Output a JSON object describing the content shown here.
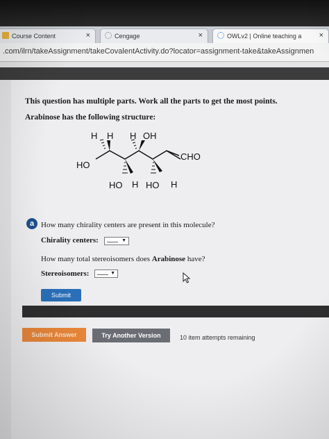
{
  "browser": {
    "tabs": [
      {
        "label": "Course Content",
        "close": "×"
      },
      {
        "label": "Cengage",
        "close": "×"
      },
      {
        "label": "OWLv2 | Online teaching a",
        "close": "×"
      }
    ],
    "url": ".com/ilrn/takeAssignment/takeCovalentActivity.do?locator=assignment-take&takeAssignmen"
  },
  "question": {
    "intro": "This question has multiple parts. Work all the parts to get the most points.",
    "structure_label": "Arabinose has the following structure:",
    "molecule_labels": {
      "h1": "H",
      "h2": "H",
      "h3": "H",
      "oh": "OH",
      "cho": "CHO",
      "ho_left": "HO",
      "ho_bottom1": "HO",
      "h_bottom1": "H",
      "ho_bottom2": "HO",
      "h_bottom2": "H"
    },
    "part_a": {
      "badge": "a",
      "chirality_question": "How many chirality centers are present in this molecule?",
      "chirality_label": "Chirality centers:",
      "chirality_value": "",
      "stereo_question_prefix": "How many total stereoisomers does ",
      "stereo_question_bold": "Arabinose",
      "stereo_question_suffix": " have?",
      "stereo_label": "Stereoisomers:",
      "stereo_value": "",
      "submit_label": "Submit"
    }
  },
  "footer": {
    "submit_answer_label": "Submit Answer",
    "try_another_label": "Try Another Version",
    "attempts_text": "10 item attempts remaining"
  },
  "colors": {
    "submit_blue": "#2a6fb8",
    "submit_answer_orange": "#e9873a",
    "try_another_gray": "#6a6e74",
    "badge_blue": "#1e4f8c"
  }
}
